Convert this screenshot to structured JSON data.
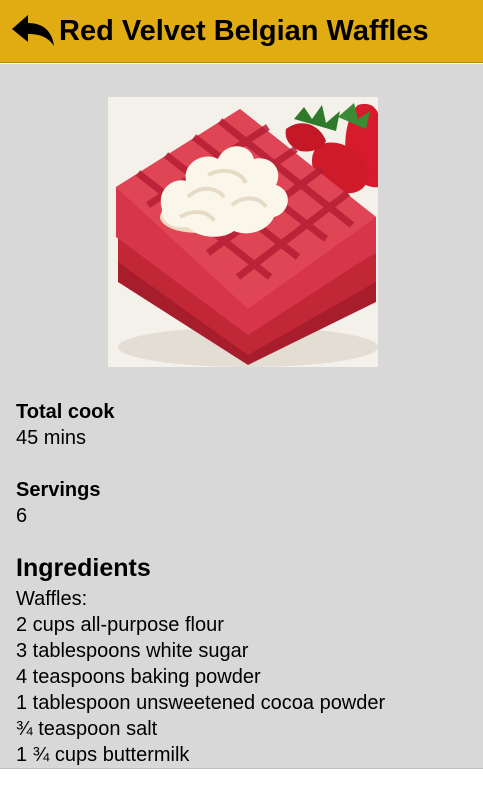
{
  "header": {
    "title": "Red Velvet Belgian Waffles",
    "back_icon": "back-arrow-icon",
    "background_color": "#e0ac12"
  },
  "recipe": {
    "total_cook_label": "Total cook",
    "total_cook_value": "45 mins",
    "servings_label": "Servings",
    "servings_value": "6",
    "ingredients_label": "Ingredients",
    "ingredients": [
      "Waffles:",
      "2 cups all-purpose flour",
      "3 tablespoons white sugar",
      "4 teaspoons baking powder",
      "1 tablespoon unsweetened cocoa powder",
      "¾ teaspoon salt",
      "1 ¾ cups buttermilk"
    ]
  }
}
